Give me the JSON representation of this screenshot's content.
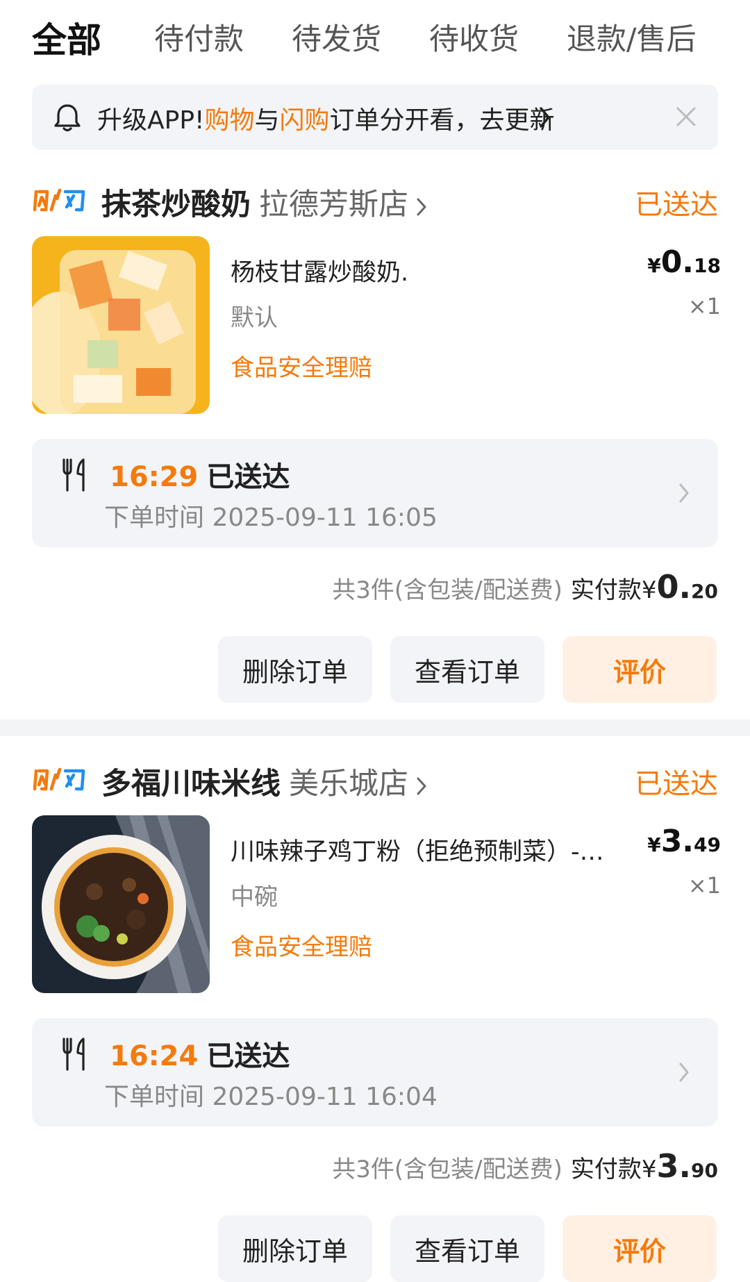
{
  "tabs": [
    "全部",
    "待付款",
    "待发货",
    "待收货",
    "退款/售后"
  ],
  "banner": {
    "part1": "升级APP!",
    "hl1": "购物",
    "part2": "与",
    "hl2": "闪购",
    "part3": "订单分开看，去更新"
  },
  "brand_label": "闪购",
  "orders": [
    {
      "store": "抹茶炒酸奶",
      "branch": "拉德芳斯店",
      "status": "已送达",
      "product": "杨枝甘露炒酸奶.",
      "spec": "默认",
      "claim": "食品安全理赔",
      "price_currency": "¥",
      "price_int": "0.",
      "price_dec": "18",
      "qty": "×1",
      "delivery_time": "16:29",
      "delivery_status": "已送达",
      "order_time": "下单时间 2025-09-11 16:05",
      "summary": "共3件(含包装/配送费)",
      "paid_label": "实付款¥",
      "paid_int": "0.",
      "paid_dec": "20",
      "buttons": [
        "删除订单",
        "查看订单",
        "评价"
      ]
    },
    {
      "store": "多福川味米线",
      "branch": "美乐城店",
      "status": "已送达",
      "product": "川味辣子鸡丁粉（拒绝预制菜）-…",
      "spec": "中碗",
      "claim": "食品安全理赔",
      "price_currency": "¥",
      "price_int": "3.",
      "price_dec": "49",
      "qty": "×1",
      "delivery_time": "16:24",
      "delivery_status": "已送达",
      "order_time": "下单时间 2025-09-11 16:04",
      "summary": "共3件(含包装/配送费)",
      "paid_label": "实付款¥",
      "paid_int": "3.",
      "paid_dec": "90",
      "buttons": [
        "删除订单",
        "查看订单",
        "评价"
      ]
    }
  ],
  "colors": {
    "accent": "#f57a0b",
    "panel": "#f2f4f7",
    "rate_bg": "#fff0e3"
  }
}
